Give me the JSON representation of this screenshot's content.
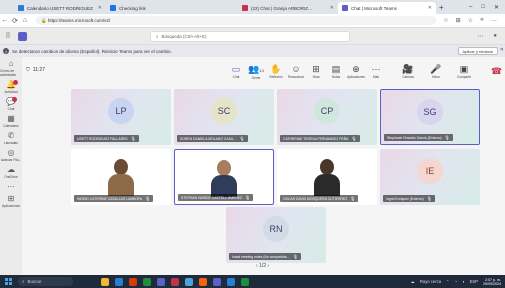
{
  "browser": {
    "tabs": [
      {
        "label": "Calendario USETT RODRIGUEZ",
        "color": "#2b7cd3",
        "active": false
      },
      {
        "label": "Checking link",
        "color": "#1a73e8",
        "active": false
      },
      {
        "label": "(22) Chat | Granja ARBORIZ…",
        "color": "#c4314b",
        "active": false
      },
      {
        "label": "Chat | Microsoft Teams",
        "color": "#5b5fc7",
        "active": true
      }
    ],
    "new_tab": "+",
    "window_controls": [
      "–",
      "□",
      "✕"
    ],
    "url": "https://teams.microsoft.com/v2/",
    "nav": [
      "←",
      "⟳",
      "⌂"
    ],
    "addr_icons": [
      "☆",
      "⊞",
      "☆",
      "⟡",
      "…"
    ]
  },
  "teams": {
    "search_placeholder": "Búsqueda (Ctrl+Alt+E)",
    "more": "⋯"
  },
  "banner": {
    "text": "Se detectaron cambios de idioma (Español). Reinicie Teams para ver el cambio.",
    "button": "Aplicar y reiniciar",
    "close": "✕"
  },
  "rail": [
    {
      "label": "Centro de actividades",
      "icon": "⌂",
      "badge": false
    },
    {
      "label": "Actividad",
      "icon": "🔔",
      "badge": true
    },
    {
      "label": "Chat",
      "icon": "💬",
      "badge": true
    },
    {
      "label": "Calendario",
      "icon": "▦",
      "badge": false
    },
    {
      "label": "Llamadas",
      "icon": "✆",
      "badge": false
    },
    {
      "label": "Avanzar Fila...",
      "icon": "◎",
      "badge": false
    },
    {
      "label": "OneDrive",
      "icon": "☁",
      "badge": false
    },
    {
      "label": "",
      "icon": "⋯",
      "badge": false
    },
    {
      "label": "Aplicaciones",
      "icon": "⊞",
      "badge": false
    }
  ],
  "meeting": {
    "timer": "11:27",
    "controls": [
      {
        "label": "Chat",
        "icon": "▭"
      },
      {
        "label": "Gente",
        "icon": "👥",
        "count": "14"
      },
      {
        "label": "Reflexión",
        "icon": "✋"
      },
      {
        "label": "Reaccionar",
        "icon": "☺"
      },
      {
        "label": "Vista",
        "icon": "⊞"
      },
      {
        "label": "Notas",
        "icon": "▤"
      },
      {
        "label": "Aplicaciones",
        "icon": "⊕"
      },
      {
        "label": "Más",
        "icon": "⋯"
      }
    ],
    "av_controls": [
      {
        "label": "Cámara",
        "icon": "🎥"
      },
      {
        "label": "Micro",
        "icon": "🎤"
      },
      {
        "label": "Compartir",
        "icon": "▣"
      }
    ],
    "leave_icon": "☎",
    "tiles": [
      {
        "initials": "LP",
        "name": "USETT RODRIGUEZ PALLARES",
        "color": "#c7d5f0",
        "kind": "avatar"
      },
      {
        "initials": "SC",
        "name": "SOREN DANIELA MOLANO CASA…",
        "color": "#e6e3c8",
        "kind": "avatar"
      },
      {
        "initials": "CP",
        "name": "CATHERINE TERESA FERNANDEZ PEÑA",
        "color": "#cfe7dd",
        "kind": "avatar"
      },
      {
        "initials": "SG",
        "name": "Stephanie Rosaldo García (Externo)",
        "color": "#d8d6ee",
        "kind": "avatar",
        "selected": true
      },
      {
        "initials": "",
        "name": "INGRID CATERINE CASALLAS LAMBOPA",
        "color": "",
        "kind": "video-woman"
      },
      {
        "initials": "",
        "name": "STEPHAN HARIDE CASTELL JIMENEZ",
        "color": "",
        "kind": "video-man",
        "selected": true
      },
      {
        "initials": "",
        "name": "OSCAR DAVID MOSQUERA GUTIERREZ",
        "color": "",
        "kind": "video-man2"
      },
      {
        "initials": "IE",
        "name": "Ingrid Enriquez (Externo)",
        "color": "#f3d7d0",
        "kind": "avatar"
      },
      {
        "initials": "RN",
        "name": "Instal meeting notes (No compartida…",
        "color": "#d3dce6",
        "kind": "avatar"
      }
    ],
    "pager": "‹   1/2   ›"
  },
  "taskbar": {
    "search": "Buscar",
    "apps": [
      "#f2b632",
      "#2b7cd3",
      "#d83b01",
      "#1e8e3e",
      "#5b5fc7",
      "#c4314b",
      "#4aa3df",
      "#f7630c",
      "#5b5fc7",
      "#2b7cd3",
      "#1e8e3e"
    ],
    "weather": "Rayo cerca",
    "lang": "ESP",
    "time": "2:07 p. m.",
    "date": "25/09/2024"
  }
}
